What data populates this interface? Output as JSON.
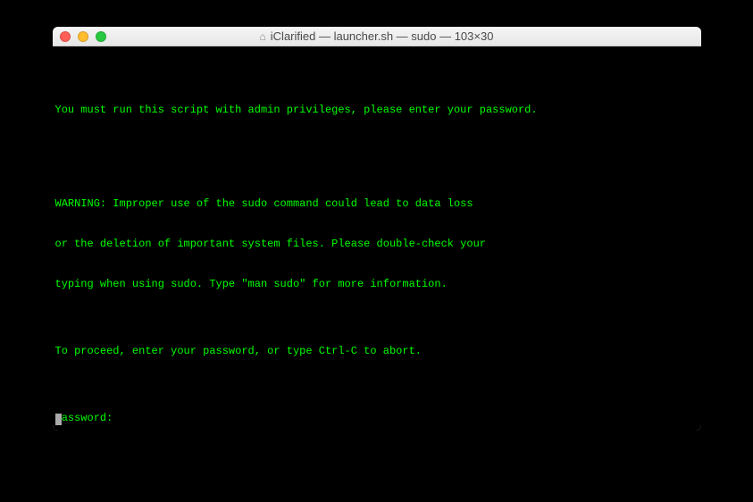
{
  "window": {
    "title": "iClarified — launcher.sh — sudo — 103×30",
    "home_icon": "⌂"
  },
  "terminal": {
    "lines": [
      "",
      "You must run this script with admin privileges, please enter your password.",
      "",
      "",
      "WARNING: Improper use of the sudo command could lead to data loss",
      "or the deletion of important system files. Please double-check your",
      "typing when using sudo. Type \"man sudo\" for more information.",
      "",
      "To proceed, enter your password, or type Ctrl-C to abort.",
      "",
      "Password:"
    ]
  }
}
